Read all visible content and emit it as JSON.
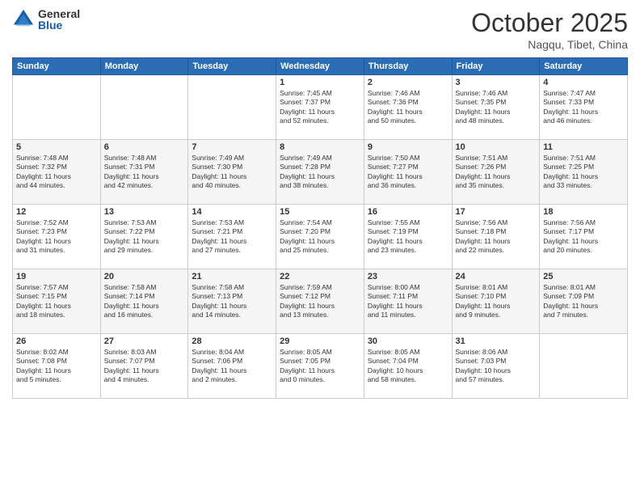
{
  "logo": {
    "general": "General",
    "blue": "Blue"
  },
  "header": {
    "month": "October 2025",
    "location": "Nagqu, Tibet, China"
  },
  "weekdays": [
    "Sunday",
    "Monday",
    "Tuesday",
    "Wednesday",
    "Thursday",
    "Friday",
    "Saturday"
  ],
  "weeks": [
    [
      {
        "day": "",
        "info": ""
      },
      {
        "day": "",
        "info": ""
      },
      {
        "day": "",
        "info": ""
      },
      {
        "day": "1",
        "info": "Sunrise: 7:45 AM\nSunset: 7:37 PM\nDaylight: 11 hours\nand 52 minutes."
      },
      {
        "day": "2",
        "info": "Sunrise: 7:46 AM\nSunset: 7:36 PM\nDaylight: 11 hours\nand 50 minutes."
      },
      {
        "day": "3",
        "info": "Sunrise: 7:46 AM\nSunset: 7:35 PM\nDaylight: 11 hours\nand 48 minutes."
      },
      {
        "day": "4",
        "info": "Sunrise: 7:47 AM\nSunset: 7:33 PM\nDaylight: 11 hours\nand 46 minutes."
      }
    ],
    [
      {
        "day": "5",
        "info": "Sunrise: 7:48 AM\nSunset: 7:32 PM\nDaylight: 11 hours\nand 44 minutes."
      },
      {
        "day": "6",
        "info": "Sunrise: 7:48 AM\nSunset: 7:31 PM\nDaylight: 11 hours\nand 42 minutes."
      },
      {
        "day": "7",
        "info": "Sunrise: 7:49 AM\nSunset: 7:30 PM\nDaylight: 11 hours\nand 40 minutes."
      },
      {
        "day": "8",
        "info": "Sunrise: 7:49 AM\nSunset: 7:28 PM\nDaylight: 11 hours\nand 38 minutes."
      },
      {
        "day": "9",
        "info": "Sunrise: 7:50 AM\nSunset: 7:27 PM\nDaylight: 11 hours\nand 36 minutes."
      },
      {
        "day": "10",
        "info": "Sunrise: 7:51 AM\nSunset: 7:26 PM\nDaylight: 11 hours\nand 35 minutes."
      },
      {
        "day": "11",
        "info": "Sunrise: 7:51 AM\nSunset: 7:25 PM\nDaylight: 11 hours\nand 33 minutes."
      }
    ],
    [
      {
        "day": "12",
        "info": "Sunrise: 7:52 AM\nSunset: 7:23 PM\nDaylight: 11 hours\nand 31 minutes."
      },
      {
        "day": "13",
        "info": "Sunrise: 7:53 AM\nSunset: 7:22 PM\nDaylight: 11 hours\nand 29 minutes."
      },
      {
        "day": "14",
        "info": "Sunrise: 7:53 AM\nSunset: 7:21 PM\nDaylight: 11 hours\nand 27 minutes."
      },
      {
        "day": "15",
        "info": "Sunrise: 7:54 AM\nSunset: 7:20 PM\nDaylight: 11 hours\nand 25 minutes."
      },
      {
        "day": "16",
        "info": "Sunrise: 7:55 AM\nSunset: 7:19 PM\nDaylight: 11 hours\nand 23 minutes."
      },
      {
        "day": "17",
        "info": "Sunrise: 7:56 AM\nSunset: 7:18 PM\nDaylight: 11 hours\nand 22 minutes."
      },
      {
        "day": "18",
        "info": "Sunrise: 7:56 AM\nSunset: 7:17 PM\nDaylight: 11 hours\nand 20 minutes."
      }
    ],
    [
      {
        "day": "19",
        "info": "Sunrise: 7:57 AM\nSunset: 7:15 PM\nDaylight: 11 hours\nand 18 minutes."
      },
      {
        "day": "20",
        "info": "Sunrise: 7:58 AM\nSunset: 7:14 PM\nDaylight: 11 hours\nand 16 minutes."
      },
      {
        "day": "21",
        "info": "Sunrise: 7:58 AM\nSunset: 7:13 PM\nDaylight: 11 hours\nand 14 minutes."
      },
      {
        "day": "22",
        "info": "Sunrise: 7:59 AM\nSunset: 7:12 PM\nDaylight: 11 hours\nand 13 minutes."
      },
      {
        "day": "23",
        "info": "Sunrise: 8:00 AM\nSunset: 7:11 PM\nDaylight: 11 hours\nand 11 minutes."
      },
      {
        "day": "24",
        "info": "Sunrise: 8:01 AM\nSunset: 7:10 PM\nDaylight: 11 hours\nand 9 minutes."
      },
      {
        "day": "25",
        "info": "Sunrise: 8:01 AM\nSunset: 7:09 PM\nDaylight: 11 hours\nand 7 minutes."
      }
    ],
    [
      {
        "day": "26",
        "info": "Sunrise: 8:02 AM\nSunset: 7:08 PM\nDaylight: 11 hours\nand 5 minutes."
      },
      {
        "day": "27",
        "info": "Sunrise: 8:03 AM\nSunset: 7:07 PM\nDaylight: 11 hours\nand 4 minutes."
      },
      {
        "day": "28",
        "info": "Sunrise: 8:04 AM\nSunset: 7:06 PM\nDaylight: 11 hours\nand 2 minutes."
      },
      {
        "day": "29",
        "info": "Sunrise: 8:05 AM\nSunset: 7:05 PM\nDaylight: 11 hours\nand 0 minutes."
      },
      {
        "day": "30",
        "info": "Sunrise: 8:05 AM\nSunset: 7:04 PM\nDaylight: 10 hours\nand 58 minutes."
      },
      {
        "day": "31",
        "info": "Sunrise: 8:06 AM\nSunset: 7:03 PM\nDaylight: 10 hours\nand 57 minutes."
      },
      {
        "day": "",
        "info": ""
      }
    ]
  ]
}
